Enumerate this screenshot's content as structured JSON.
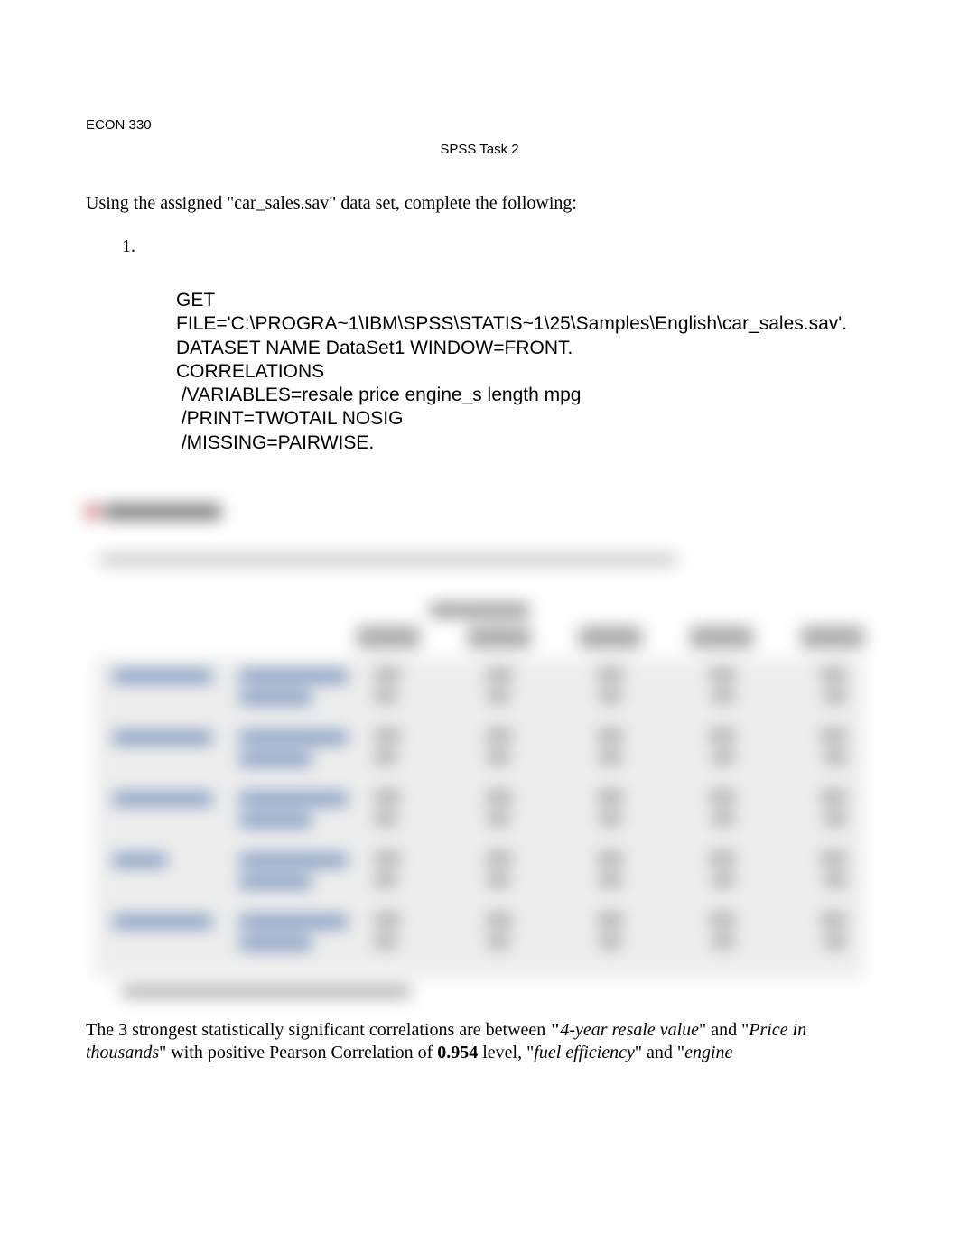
{
  "header": {
    "course": "ECON 330",
    "title": "SPSS Task 2"
  },
  "intro": "Using the assigned \"car_sales.sav\" data set, complete the following:",
  "list_number": "1.",
  "code": {
    "l1": "GET",
    "l2": "FILE='C:\\PROGRA~1\\IBM\\SPSS\\STATIS~1\\25\\Samples\\English\\car_sales.sav'.",
    "l3": "DATASET NAME DataSet1 WINDOW=FRONT.",
    "l4": "CORRELATIONS",
    "l5": " /VARIABLES=resale price engine_s length mpg",
    "l6": " /PRINT=TWOTAIL NOSIG",
    "l7": " /MISSING=PAIRWISE."
  },
  "conclusion": {
    "pre1": "The 3 strongest statistically significant correlations are between ",
    "bold_open_quote": "\"",
    "i1": "4-year resale value",
    "post_q1": "\" and \"",
    "i2": "Price in thousands",
    "post_q2": "\" with positive Pearson Correlation of ",
    "b1": "0.954",
    "post_b1": " level, \"",
    "i3": "fuel efficiency",
    "post_q3": "\" and \"",
    "i4": "engine"
  }
}
